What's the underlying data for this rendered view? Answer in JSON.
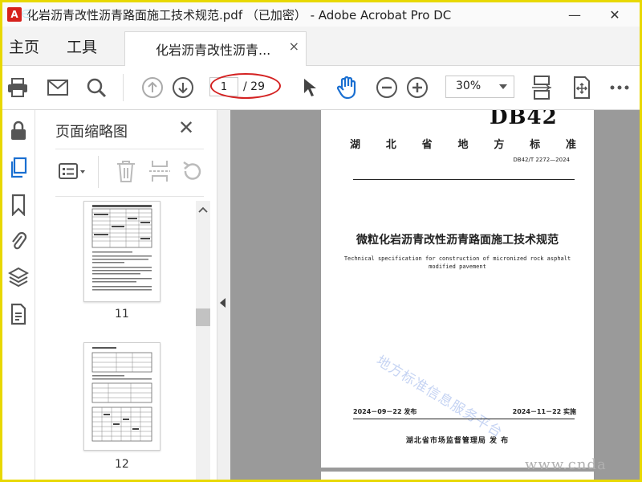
{
  "window": {
    "title": "化岩沥青改性沥青路面施工技术规范.pdf （已加密） - Adobe Acrobat Pro DC",
    "minimize": "—",
    "close": "✕"
  },
  "menu": {
    "home": "主页",
    "tools": "工具"
  },
  "tab": {
    "label": "化岩沥青改性沥青...",
    "close": "×"
  },
  "toolbar": {
    "current_page": "1",
    "total_pages": "/ 29",
    "zoom": "30%"
  },
  "thumbnails": {
    "title": "页面缩略图",
    "close": "✕",
    "items": [
      {
        "label": "11"
      },
      {
        "label": "12"
      }
    ]
  },
  "document": {
    "standard_code": "DB42",
    "province_header": [
      "湖",
      "北",
      "省",
      "地",
      "方",
      "标",
      "准"
    ],
    "number": "DB42/T 2272—2024",
    "title_cn": "微粒化岩沥青改性沥青路面施工技术规范",
    "title_en_line1": "Technical specification for construction of micronized rock asphalt",
    "title_en_line2": "modified pavement",
    "watermark": "地方标准信息服务平台",
    "publish_date": "2024－09－22 发布",
    "effective_date": "2024－11－22 实施",
    "issuer": "湖北省市场监督管理局  发 布",
    "site_watermark": "www.cnda"
  },
  "colors": {
    "frame": "#e8d800",
    "annotation": "#d42222",
    "acrobat_red": "#d6211c"
  }
}
